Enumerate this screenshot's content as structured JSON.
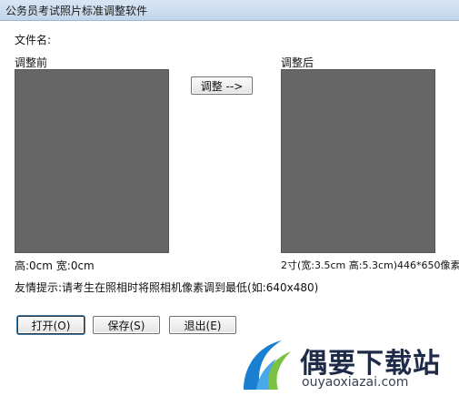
{
  "window": {
    "title": "公务员考试照片标准调整软件"
  },
  "file": {
    "label": "文件名:"
  },
  "before": {
    "label": "调整前",
    "info": "高:0cm  宽:0cm"
  },
  "after": {
    "label": "调整后",
    "info": "2寸(宽:3.5cm 高:5.3cm)446*650像素"
  },
  "adjust_button": "调整 -->",
  "tip": "友情提示:请考生在照相时将照相机像素调到最低(如:640x480)",
  "buttons": {
    "open": "打开(O)",
    "save": "保存(S)",
    "exit": "退出(E)"
  },
  "watermark": {
    "name": "偶要下载站",
    "domain": "ouyaoxiazai.com"
  },
  "colors": {
    "image_placeholder": "#666666",
    "logo_blue": "#1a7fd0",
    "logo_green": "#7cc242"
  }
}
